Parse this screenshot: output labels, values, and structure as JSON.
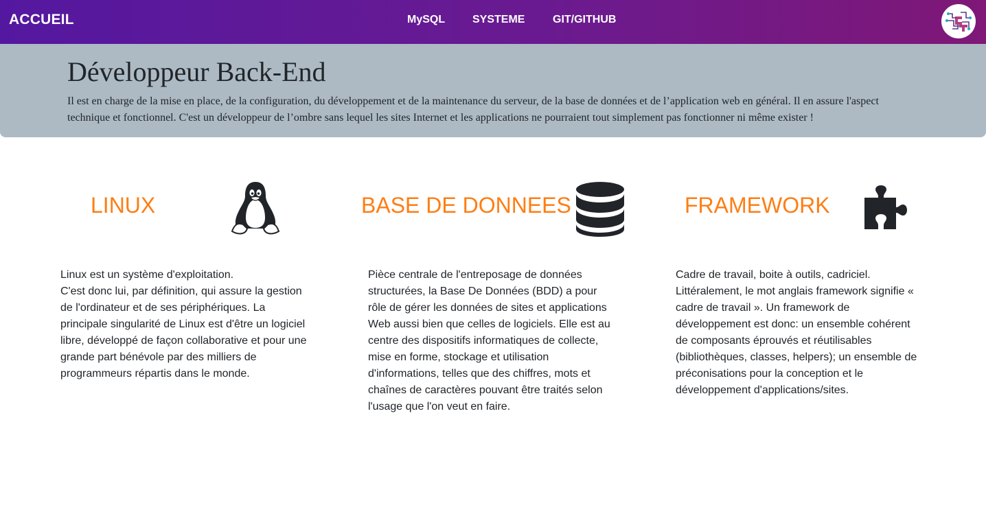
{
  "nav": {
    "brand": "ACCUEIL",
    "links": [
      "MySQL",
      "SYSTEME",
      "GIT/GITHUB"
    ],
    "logo_icon": "circuit-logo-icon"
  },
  "jumbotron": {
    "title": "Développeur Back-End",
    "text": "Il est en charge de la mise en place, de la configuration, du développement et de la maintenance du serveur, de la base de données et de l’application web en général. Il en assure l'aspect technique et fonctionnel. C'est un développeur de l’ombre sans lequel les sites Internet et les applications ne pourraient tout simplement pas fonctionner ni même exister !"
  },
  "columns": [
    {
      "title": "LINUX",
      "icon": "linux-tux-icon",
      "lines": [
        "Linux est un système d'exploitation.",
        "C'est donc lui, par définition, qui assure la gestion",
        "de l'ordinateur et de ses périphériques. La",
        "principale singularité de Linux est d'être un logiciel",
        "libre, développé de façon collaborative et pour une",
        "grande part bénévole par des milliers de",
        "programmeurs répartis dans le monde."
      ]
    },
    {
      "title": "BASE DE DONNEES",
      "icon": "database-icon",
      "lines": [
        "Pièce centrale de l'entreposage de données",
        "structurées, la Base De Données (BDD) a pour",
        "rôle de gérer les données de sites et applications",
        "Web aussi bien que celles de logiciels. Elle est au",
        "centre des dispositifs informatiques de collecte,",
        "mise en forme, stockage et utilisation",
        "d'informations, telles que des chiffres, mots et",
        "chaînes de caractères pouvant être traités selon",
        "l'usage que l'on veut en faire."
      ]
    },
    {
      "title": "FRAMEWORK",
      "icon": "puzzle-piece-icon",
      "lines": [
        "Cadre de travail, boite à outils, cadriciel.",
        "Littéralement, le mot anglais framework signifie «",
        "cadre de travail ». Un framework de",
        "développement est donc: un ensemble cohérent",
        "de composants éprouvés et réutilisables",
        "(bibliothèques, classes, helpers); un ensemble de",
        "préconisations pour la conception et le",
        "développement d'applications/sites."
      ]
    }
  ],
  "colors": {
    "nav_gradient_start": "#5418a0",
    "nav_gradient_end": "#7f1877",
    "jumbotron_bg": "#adbac4",
    "accent_orange": "#fd7e14",
    "icon_dark": "#212529"
  }
}
